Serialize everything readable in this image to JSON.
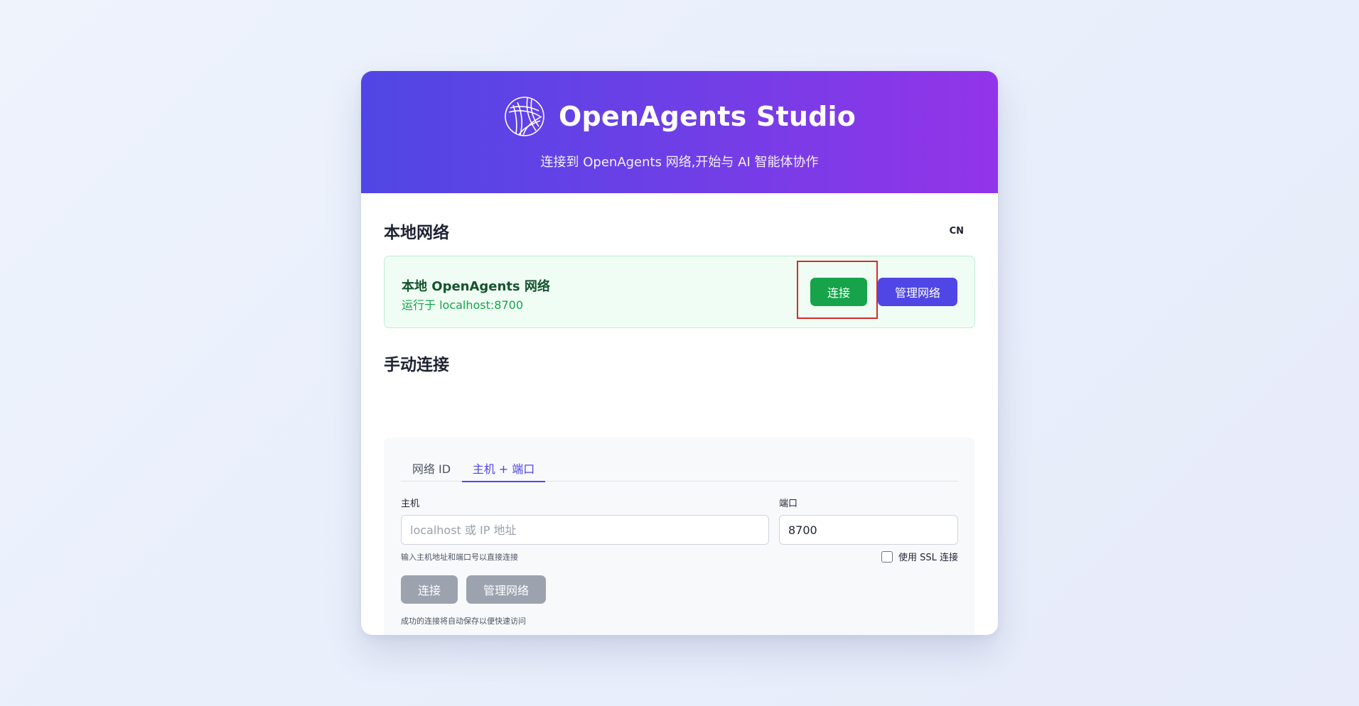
{
  "header": {
    "title": "OpenAgents Studio",
    "subtitle": "连接到 OpenAgents 网络,开始与 AI 智能体协作",
    "logo_icon": "openagents-logo-icon"
  },
  "local": {
    "section_title": "本地网络",
    "lang_toggle": "CN",
    "network_name": "本地 OpenAgents 网络",
    "network_address": "运行于 localhost:8700",
    "connect_label": "连接",
    "manage_label": "管理网络"
  },
  "manual": {
    "section_title": "手动连接",
    "tabs": [
      {
        "label": "网络 ID",
        "active": false
      },
      {
        "label": "主机 + 端口",
        "active": true
      }
    ],
    "host_label": "主机",
    "host_placeholder": "localhost 或 IP 地址",
    "host_value": "",
    "port_label": "端口",
    "port_value": "8700",
    "host_hint": "输入主机地址和端口号以直接连接",
    "ssl_label": "使用 SSL 连接",
    "ssl_checked": false,
    "connect_label": "连接",
    "manage_label": "管理网络",
    "save_hint": "成功的连接将自动保存以便快速访问"
  },
  "colors": {
    "header_start": "#5046e5",
    "header_end": "#9334e9",
    "connect_green": "#16a34a",
    "primary_indigo": "#4f46e5",
    "disabled_gray": "#9ca3af",
    "highlight_red": "#d62b2b"
  }
}
